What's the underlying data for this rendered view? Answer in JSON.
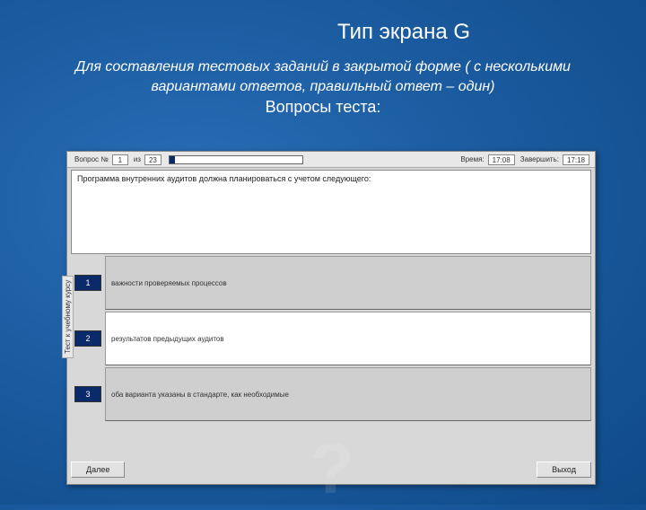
{
  "slide": {
    "title": "Тип экрана G",
    "subtitle": "Для составления тестовых заданий в закрытой форме ( с несколькими вариантами ответов, правильный ответ – один)",
    "heading": "Вопросы теста:"
  },
  "topbar": {
    "question_label": "Вопрос №",
    "current": "1",
    "of_label": "из",
    "total": "23",
    "time_label": "Время:",
    "time_value": "17:08",
    "end_label": "Завершить:",
    "end_value": "17:18"
  },
  "question": {
    "text": "Программа внутренних аудитов должна планироваться с учетом следующего:"
  },
  "side_label": "Тест к учебному курсу",
  "answers": [
    {
      "num": "1",
      "text": "важности проверяемых процессов"
    },
    {
      "num": "2",
      "text": "результатов предыдущих аудитов"
    },
    {
      "num": "3",
      "text": "оба варианта указаны в стандарте, как необходимые"
    }
  ],
  "buttons": {
    "next": "Далее",
    "exit": "Выход"
  }
}
